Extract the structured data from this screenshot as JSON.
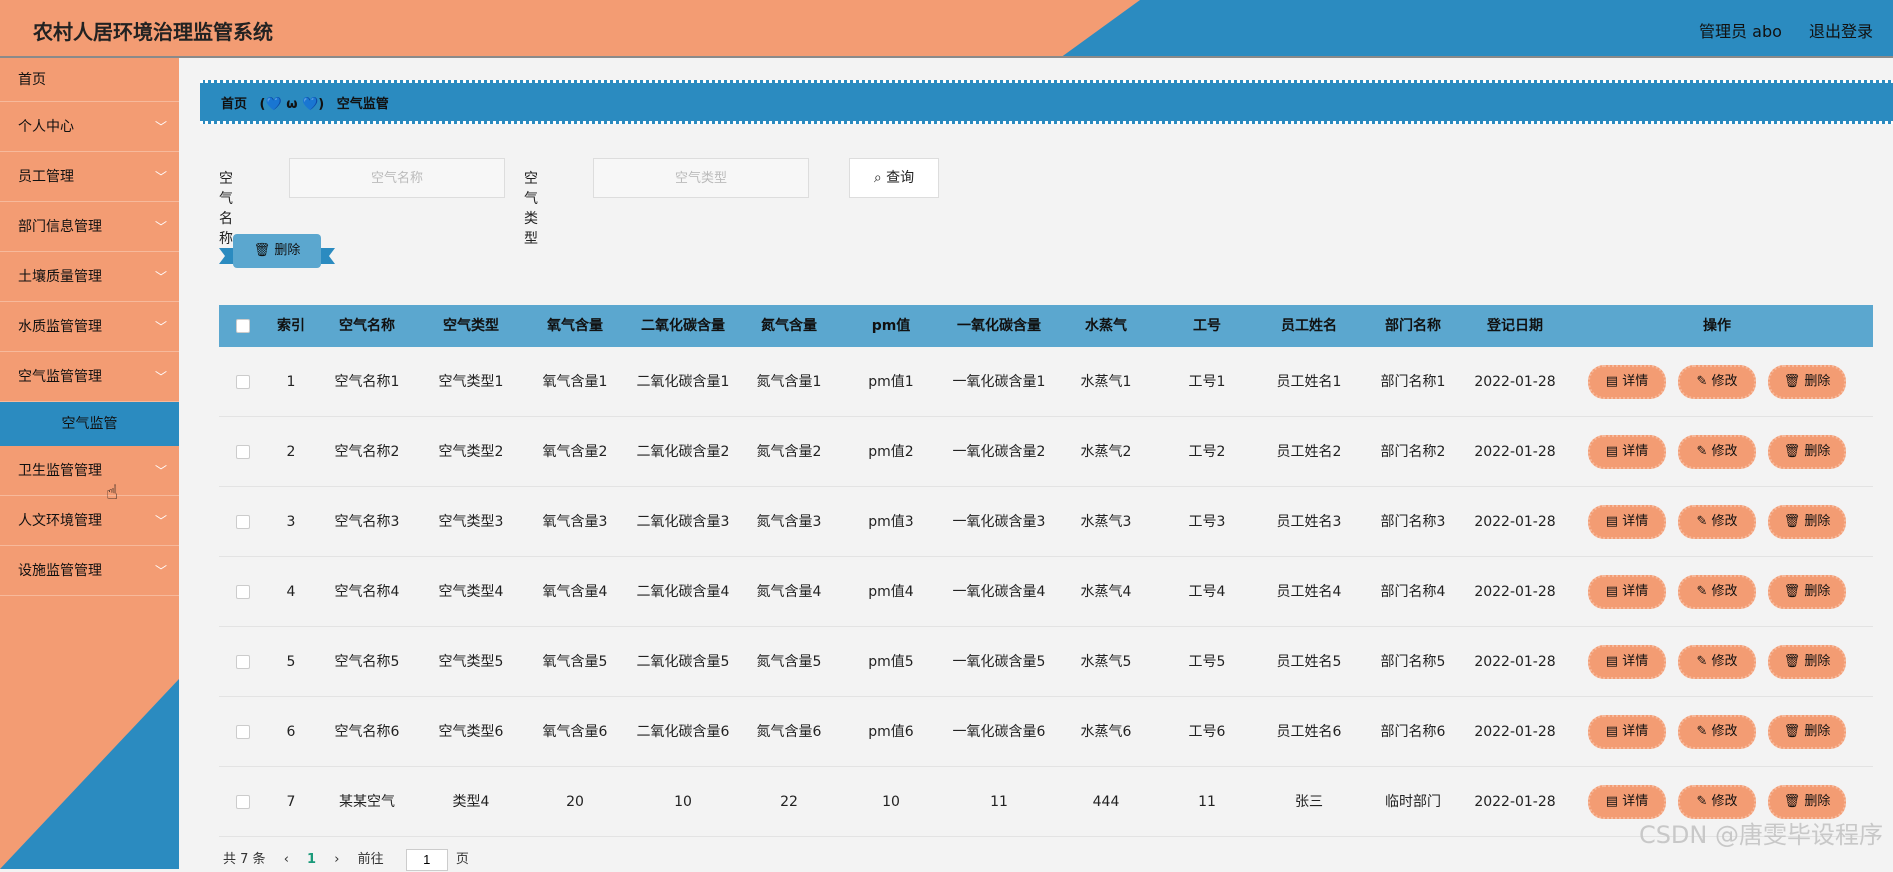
{
  "header": {
    "title": "农村人居环境治理监管系统",
    "user": "管理员 abo",
    "logout": "退出登录"
  },
  "colors": {
    "orange": "#f39c73",
    "blue": "#2b8bc0",
    "table_header": "#5ba7cf"
  },
  "sidebar": {
    "items": [
      {
        "label": "首页"
      },
      {
        "label": "个人中心",
        "chevron": "﹀"
      },
      {
        "label": "员工管理",
        "chevron": "﹀"
      },
      {
        "label": "部门信息管理",
        "chevron": "﹀"
      },
      {
        "label": "土壤质量管理",
        "chevron": "﹀"
      },
      {
        "label": "水质监管管理",
        "chevron": "﹀"
      },
      {
        "label": "空气监管管理",
        "chevron": "﹀"
      },
      {
        "label": "卫生监管管理",
        "chevron": "﹀"
      },
      {
        "label": "人文环境管理",
        "chevron": "﹀"
      },
      {
        "label": "设施监管管理",
        "chevron": "﹀"
      }
    ],
    "subitem": {
      "label": "空气监管"
    },
    "cursor_icon": "☝"
  },
  "breadcrumb": {
    "home": "首页",
    "separator": "(💙 ω 💙)",
    "current": "空气监管"
  },
  "search": {
    "name_label": "空气名称",
    "name_placeholder": "空气名称",
    "type_label": "空气类型",
    "type_placeholder": "空气类型",
    "query_icon": "⌕",
    "query_label": "查询"
  },
  "batch_delete": {
    "icon": "🗑",
    "label": "删除"
  },
  "table": {
    "headers": [
      "",
      "索引",
      "空气名称",
      "空气类型",
      "氧气含量",
      "二氧化碳含量",
      "氮气含量",
      "pm值",
      "一氧化碳含量",
      "水蒸气",
      "工号",
      "员工姓名",
      "部门名称",
      "登记日期",
      "操作"
    ],
    "rows": [
      [
        "1",
        "空气名称1",
        "空气类型1",
        "氧气含量1",
        "二氧化碳含量1",
        "氮气含量1",
        "pm值1",
        "一氧化碳含量1",
        "水蒸气1",
        "工号1",
        "员工姓名1",
        "部门名称1",
        "2022-01-28"
      ],
      [
        "2",
        "空气名称2",
        "空气类型2",
        "氧气含量2",
        "二氧化碳含量2",
        "氮气含量2",
        "pm值2",
        "一氧化碳含量2",
        "水蒸气2",
        "工号2",
        "员工姓名2",
        "部门名称2",
        "2022-01-28"
      ],
      [
        "3",
        "空气名称3",
        "空气类型3",
        "氧气含量3",
        "二氧化碳含量3",
        "氮气含量3",
        "pm值3",
        "一氧化碳含量3",
        "水蒸气3",
        "工号3",
        "员工姓名3",
        "部门名称3",
        "2022-01-28"
      ],
      [
        "4",
        "空气名称4",
        "空气类型4",
        "氧气含量4",
        "二氧化碳含量4",
        "氮气含量4",
        "pm值4",
        "一氧化碳含量4",
        "水蒸气4",
        "工号4",
        "员工姓名4",
        "部门名称4",
        "2022-01-28"
      ],
      [
        "5",
        "空气名称5",
        "空气类型5",
        "氧气含量5",
        "二氧化碳含量5",
        "氮气含量5",
        "pm值5",
        "一氧化碳含量5",
        "水蒸气5",
        "工号5",
        "员工姓名5",
        "部门名称5",
        "2022-01-28"
      ],
      [
        "6",
        "空气名称6",
        "空气类型6",
        "氧气含量6",
        "二氧化碳含量6",
        "氮气含量6",
        "pm值6",
        "一氧化碳含量6",
        "水蒸气6",
        "工号6",
        "员工姓名6",
        "部门名称6",
        "2022-01-28"
      ],
      [
        "7",
        "某某空气",
        "类型4",
        "20",
        "10",
        "22",
        "10",
        "11",
        "444",
        "11",
        "张三",
        "临时部门",
        "2022-01-28"
      ]
    ],
    "actions": [
      {
        "icon": "▤",
        "label": "详情"
      },
      {
        "icon": "✎",
        "label": "修改"
      },
      {
        "icon": "🗑",
        "label": "删除"
      }
    ]
  },
  "pagination": {
    "total": "共 7 条",
    "prev": "‹",
    "current": "1",
    "next": "›",
    "goto": "前往",
    "page_value": "1",
    "page_unit": "页"
  },
  "watermark": "CSDN @唐雯毕设程序"
}
